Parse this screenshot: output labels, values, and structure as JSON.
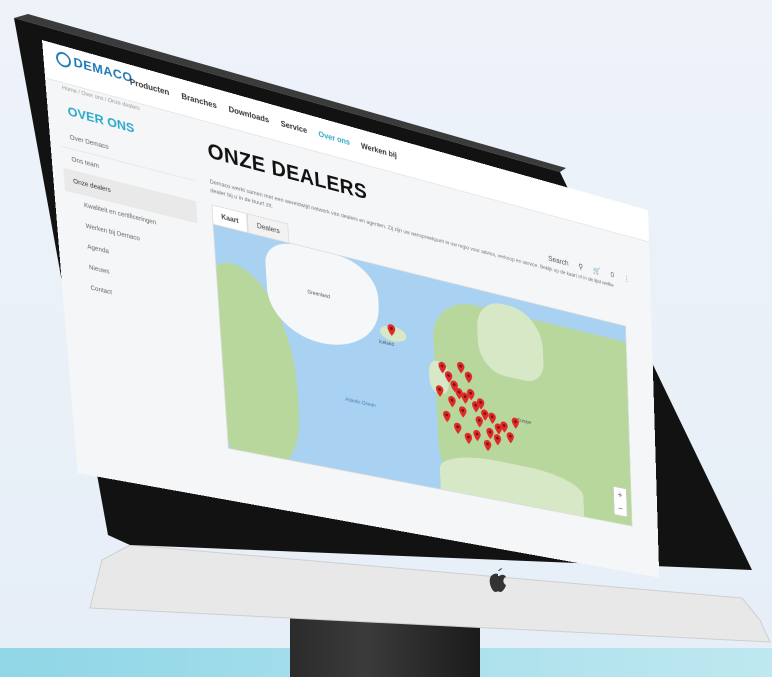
{
  "brand": {
    "name": "DEMACO"
  },
  "nav": {
    "items": [
      {
        "label": "Producten"
      },
      {
        "label": "Branches"
      },
      {
        "label": "Downloads"
      },
      {
        "label": "Service"
      },
      {
        "label": "Over ons"
      },
      {
        "label": "Werken bij"
      }
    ],
    "active_index": 4
  },
  "breadcrumb": {
    "text": "Home / Over ons / Onze dealers"
  },
  "sidebar": {
    "title": "OVER ONS",
    "items": [
      {
        "label": "Over Demaco"
      },
      {
        "label": "Ons team"
      },
      {
        "label": "Onze dealers"
      }
    ],
    "subitems": [
      {
        "label": "Kwaliteit en certificeringen"
      },
      {
        "label": "Werken bij Demaco"
      },
      {
        "label": "Agenda"
      },
      {
        "label": "Nieuws"
      },
      {
        "label": "Contact"
      }
    ],
    "active_index": 2
  },
  "main": {
    "title": "ONZE DEALERS",
    "description": "Demaco werkt samen met een wereldwijd netwerk van dealers en agenten. Zij zijn uw aanspreekpunt in uw regio voor advies, verkoop en service. Bekijk op de kaart of in de lijst welke dealer bij u in de buurt zit.",
    "tools": {
      "search": "Search",
      "cart": "0"
    },
    "tabs": [
      {
        "label": "Kaart"
      },
      {
        "label": "Dealers"
      }
    ],
    "active_tab": 0
  },
  "map": {
    "labels": [
      {
        "text": "Greenland"
      },
      {
        "text": "Iceland"
      },
      {
        "text": "Europe"
      },
      {
        "text": "Atlantic Ocean"
      }
    ],
    "pin_count": 28
  },
  "colors": {
    "accent": "#2aa8c9",
    "brand": "#1e78b8",
    "pin": "#e02a2a"
  }
}
